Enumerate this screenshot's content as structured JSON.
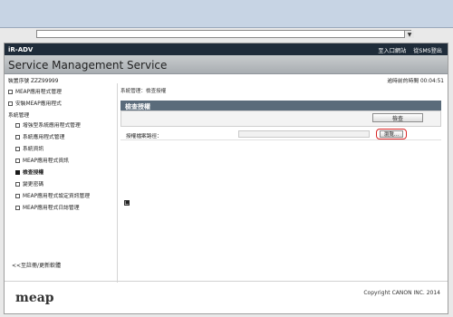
{
  "top": {
    "address_dropdown_glyph": "▼"
  },
  "header": {
    "brand": "iR-ADV",
    "links": [
      "至入口網站",
      "從SMS登出"
    ]
  },
  "banner": {
    "title": "Service Management Service"
  },
  "device": {
    "id_label": "裝置序號 ZZZ99999",
    "timer_label": "逾時前的時間 00:04:51"
  },
  "sidebar": {
    "items": [
      {
        "label": "MEAP應用程式管理"
      },
      {
        "label": "安裝MEAP應用程式"
      },
      {
        "label": "系統管理"
      },
      {
        "label": "增強型系統應用程式管理"
      },
      {
        "label": "系統應用程式管理"
      },
      {
        "label": "系統資訊"
      },
      {
        "label": "MEAP應用程式資訊"
      },
      {
        "label": "檢查授權"
      },
      {
        "label": "變更密碼"
      },
      {
        "label": "MEAP應用程式設定資訊管理"
      },
      {
        "label": "MEAP應用程式日誌管理"
      }
    ],
    "back_link": "<<至註冊/更新軟體"
  },
  "content": {
    "breadcrumb": "系統管理：檢查授權",
    "panel_title": "檢查授權",
    "check_button": "檢查",
    "path_label": "授權檔案路徑：",
    "browse_button": "瀏覽..."
  },
  "footer": {
    "logo": "meap",
    "copyright": "Copyright CANON INC. 2014"
  }
}
